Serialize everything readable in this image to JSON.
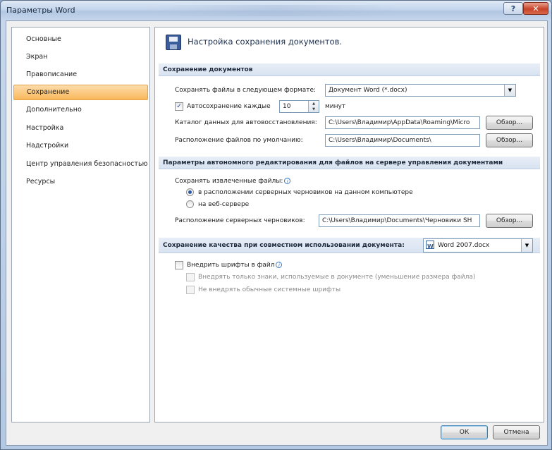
{
  "window": {
    "title": "Параметры Word",
    "help_label": "?",
    "close_label": "✕"
  },
  "nav": {
    "items": [
      {
        "label": "Основные"
      },
      {
        "label": "Экран"
      },
      {
        "label": "Правописание"
      },
      {
        "label": "Сохранение",
        "selected": true
      },
      {
        "label": "Дополнительно"
      },
      {
        "label": "Настройка"
      },
      {
        "label": "Надстройки"
      },
      {
        "label": "Центр управления безопасностью"
      },
      {
        "label": "Ресурсы"
      }
    ]
  },
  "header": {
    "title": "Настройка сохранения документов."
  },
  "save_docs": {
    "section_title": "Сохранение документов",
    "format_label": "Сохранять файлы в следующем формате:",
    "format_value": "Документ Word (*.docx)",
    "autosave_checked": true,
    "autosave_label": "Автосохранение каждые",
    "autosave_value": "10",
    "autosave_unit": "минут",
    "autorecover_label": "Каталог данных для автовосстановления:",
    "autorecover_path": "C:\\Users\\Владимир\\AppData\\Roaming\\Micro",
    "default_location_label": "Расположение файлов по умолчанию:",
    "default_location_path": "C:\\Users\\Владимир\\Documents\\",
    "browse_label": "Обзор..."
  },
  "offline": {
    "section_title": "Параметры автономного редактирования для файлов на сервере управления документами",
    "save_checked_out_label": "Сохранять извлеченные файлы:",
    "info_glyph": "i",
    "option_local": "в расположении серверных черновиков на данном компьютере",
    "option_web": "на веб-сервере",
    "selected_option": "local",
    "drafts_label": "Расположение серверных черновиков:",
    "drafts_path": "C:\\Users\\Владимир\\Documents\\Черновики SH",
    "browse_label": "Обзор..."
  },
  "fidelity": {
    "section_title": "Сохранение качества при совместном использовании документа:",
    "document_value": "Word 2007.docx",
    "embed_fonts_label": "Внедрить шрифты в файл",
    "embed_fonts_checked": false,
    "embed_only_used_label": "Внедрять только знаки, используемые в документе (уменьшение размера файла)",
    "dont_embed_system_label": "Не внедрять обычные системные шрифты"
  },
  "footer": {
    "ok_label": "ОК",
    "cancel_label": "Отмена"
  }
}
